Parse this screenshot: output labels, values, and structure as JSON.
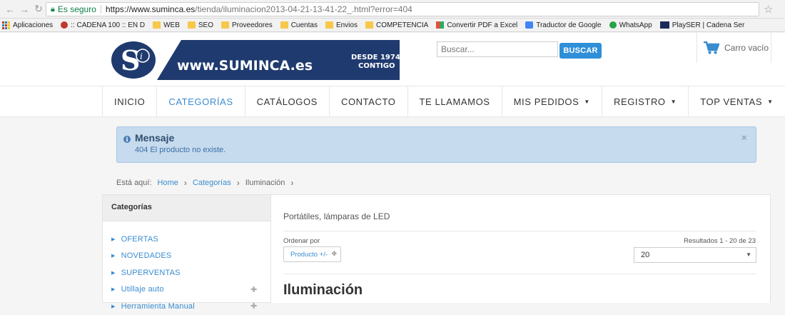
{
  "browser": {
    "secure_label": "Es seguro",
    "url_host": "https://www.suminca.es",
    "url_path": "/tienda/iluminacion2013-04-21-13-41-22_.html?error=404",
    "bookmarks": [
      {
        "label": "Aplicaciones",
        "icon": "apps-icon"
      },
      {
        "label": ":: CADENA 100 :: EN D",
        "icon": "cadena100-icon"
      },
      {
        "label": "WEB",
        "icon": "folder-icon"
      },
      {
        "label": "SEO",
        "icon": "folder-icon"
      },
      {
        "label": "Proveedores",
        "icon": "folder-icon"
      },
      {
        "label": "Cuentas",
        "icon": "folder-icon"
      },
      {
        "label": "Envios",
        "icon": "folder-icon"
      },
      {
        "label": "COMPETENCIA",
        "icon": "folder-icon"
      },
      {
        "label": "Convertir PDF a Excel",
        "icon": "pdf-icon"
      },
      {
        "label": "Traductor de Google",
        "icon": "translate-icon"
      },
      {
        "label": "WhatsApp",
        "icon": "whatsapp-icon"
      },
      {
        "label": "PlaySER | Cadena Ser",
        "icon": "playser-icon"
      }
    ]
  },
  "header": {
    "logo_url_text": "www.SUMINCA.es",
    "logo_tag_1": "DESDE 1974",
    "logo_tag_2": "CONTIGO",
    "search_placeholder": "Buscar...",
    "search_button": "BUSCAR",
    "cart_label": "Carro vacío"
  },
  "nav": {
    "items": [
      {
        "label": "INICIO"
      },
      {
        "label": "CATEGORÍAS"
      },
      {
        "label": "CATÁLOGOS"
      },
      {
        "label": "CONTACTO"
      },
      {
        "label": "TE LLAMAMOS"
      },
      {
        "label": "MIS PEDIDOS"
      },
      {
        "label": "REGISTRO"
      },
      {
        "label": "TOP VENTAS"
      }
    ]
  },
  "alert": {
    "title": "Mensaje",
    "text": "404 El producto no existe.",
    "close": "×"
  },
  "breadcrumb": {
    "prefix": "Está aquí:",
    "home": "Home",
    "categories": "Categorías",
    "current": "Iluminación"
  },
  "sidebar": {
    "title": "Categorías",
    "items": [
      {
        "label": "OFERTAS"
      },
      {
        "label": "NOVEDADES"
      },
      {
        "label": "SUPERVENTAS"
      },
      {
        "label": "Utillaje auto"
      },
      {
        "label": "Herramienta Manual"
      }
    ]
  },
  "content": {
    "subtitle": "Portátiles, lámparas de LED",
    "sort_label": "Ordenar por",
    "sort_button": "Producto +/-",
    "results": "Resultados 1 - 20 de 23",
    "per_page": "20",
    "title": "Iluminación"
  },
  "colors": {
    "accent": "#3a8ccf",
    "logo_navy": "#1f3a6e",
    "alert_bg": "#c6dbee"
  }
}
